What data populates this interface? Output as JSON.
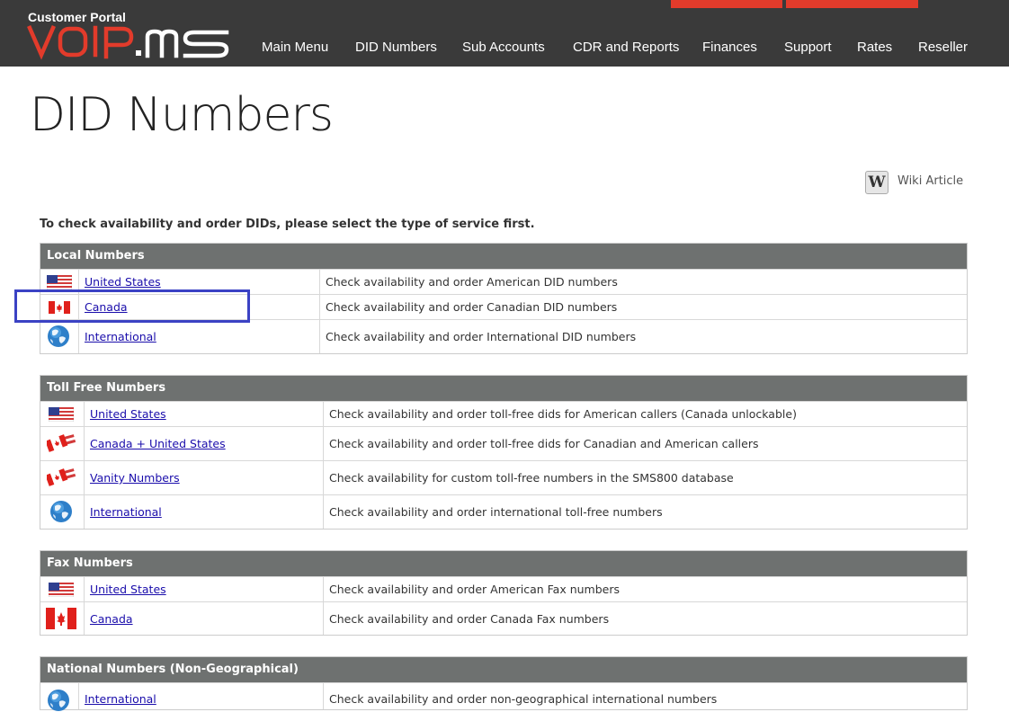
{
  "header": {
    "brand_top": "Customer Portal",
    "logo_text": "VOiP.MS",
    "nav": [
      {
        "label": "Main Menu"
      },
      {
        "label": "DID Numbers"
      },
      {
        "label": "Sub Accounts"
      },
      {
        "label": "CDR and Reports"
      },
      {
        "label": "Finances"
      },
      {
        "label": "Support"
      },
      {
        "label": "Rates"
      },
      {
        "label": "Reseller"
      }
    ]
  },
  "page": {
    "title": "DID Numbers",
    "wiki_icon": "W",
    "wiki_label": "Wiki Article",
    "intro": "To check availability and order DIDs, please select the type of service first."
  },
  "sections": [
    {
      "title": "Local Numbers",
      "rows": [
        {
          "icon": "us-flag-icon",
          "name": "United States",
          "desc": "Check availability and order American DID numbers"
        },
        {
          "icon": "canada-flag-icon",
          "name": "Canada",
          "desc": "Check availability and order Canadian DID numbers"
        },
        {
          "icon": "globe-icon",
          "name": "International",
          "desc": "Check availability and order International DID numbers"
        }
      ]
    },
    {
      "title": "Toll Free Numbers",
      "rows": [
        {
          "icon": "us-flag-icon",
          "name": "United States",
          "desc": "Check availability and order toll-free dids for American callers (Canada unlockable)"
        },
        {
          "icon": "canada-us-flags-icon",
          "name": "Canada + United States",
          "desc": "Check availability and order toll-free dids for Canadian and American callers"
        },
        {
          "icon": "canada-us-flags-icon",
          "name": "Vanity Numbers",
          "desc": "Check availability for custom toll-free numbers in the SMS800 database"
        },
        {
          "icon": "globe-icon",
          "name": "International",
          "desc": "Check availability and order international toll-free numbers"
        }
      ]
    },
    {
      "title": "Fax Numbers",
      "rows": [
        {
          "icon": "us-flag-icon",
          "name": "United States",
          "desc": "Check availability and order American Fax numbers"
        },
        {
          "icon": "canada-flag-icon",
          "name": "Canada",
          "desc": "Check availability and order Canada Fax numbers"
        }
      ]
    },
    {
      "title": "National Numbers (Non-Geographical)",
      "rows": [
        {
          "icon": "globe-icon",
          "name": "International",
          "desc": "Check availability and order non-geographical international numbers"
        }
      ]
    }
  ],
  "colors": {
    "header_bg": "#3a3a3a",
    "accent_red": "#e23b2b",
    "section_header_bg": "#6e7170",
    "link": "#1a0dab",
    "highlight_box": "#3b42c4"
  }
}
